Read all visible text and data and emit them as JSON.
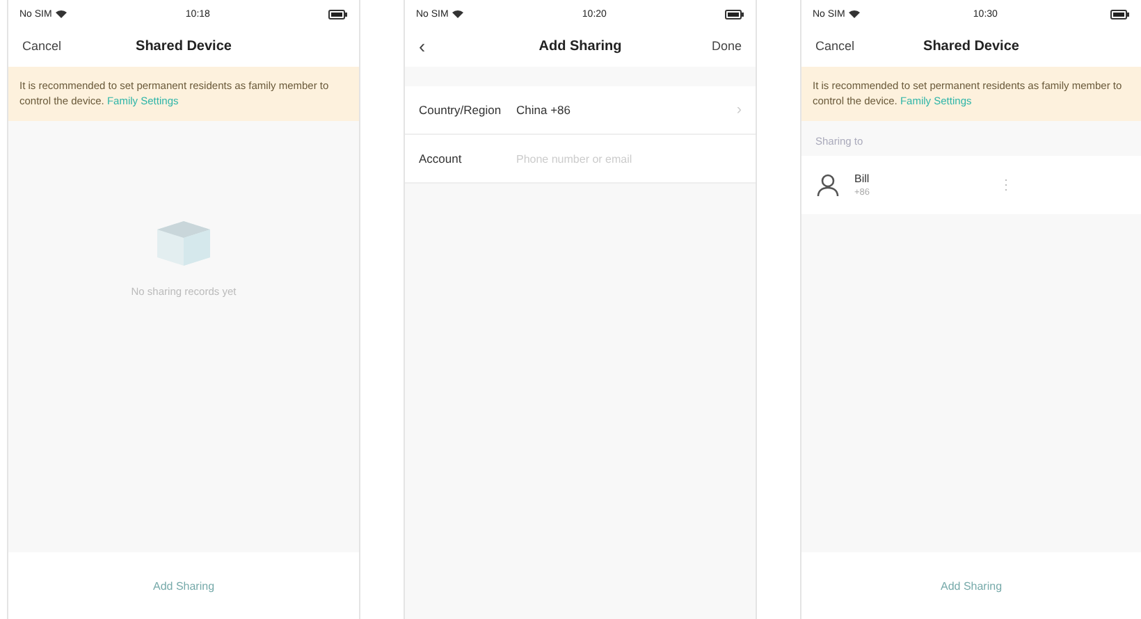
{
  "screens": [
    {
      "kind": "empty",
      "status": {
        "carrier": "No SIM",
        "time": "10:18"
      },
      "nav": {
        "left": "Cancel",
        "title": "Shared Device"
      },
      "notice": {
        "text": "It is recommended to set permanent residents as family member to control the device.",
        "link": "Family Settings"
      },
      "empty_text": "No sharing records yet",
      "bottom_button": "Add Sharing"
    },
    {
      "kind": "form",
      "status": {
        "carrier": "No SIM",
        "time": "10:20"
      },
      "nav": {
        "back": "‹",
        "title": "Add Sharing",
        "right": "Done"
      },
      "fields": [
        {
          "label": "Country/Region",
          "value": "China +86",
          "chevron": "›"
        },
        {
          "label": "Account",
          "placeholder": "Phone number or email"
        }
      ]
    },
    {
      "kind": "list",
      "status": {
        "carrier": "No SIM",
        "time": "10:30"
      },
      "nav": {
        "left": "Cancel",
        "title": "Shared Device"
      },
      "notice": {
        "text": "It is recommended to set permanent residents as family member to control the device.",
        "link": "Family Settings"
      },
      "section": "Sharing to",
      "members": [
        {
          "name": "Bill",
          "sub": "+86",
          "more": "⋮"
        }
      ],
      "bottom_button": "Add Sharing"
    }
  ]
}
